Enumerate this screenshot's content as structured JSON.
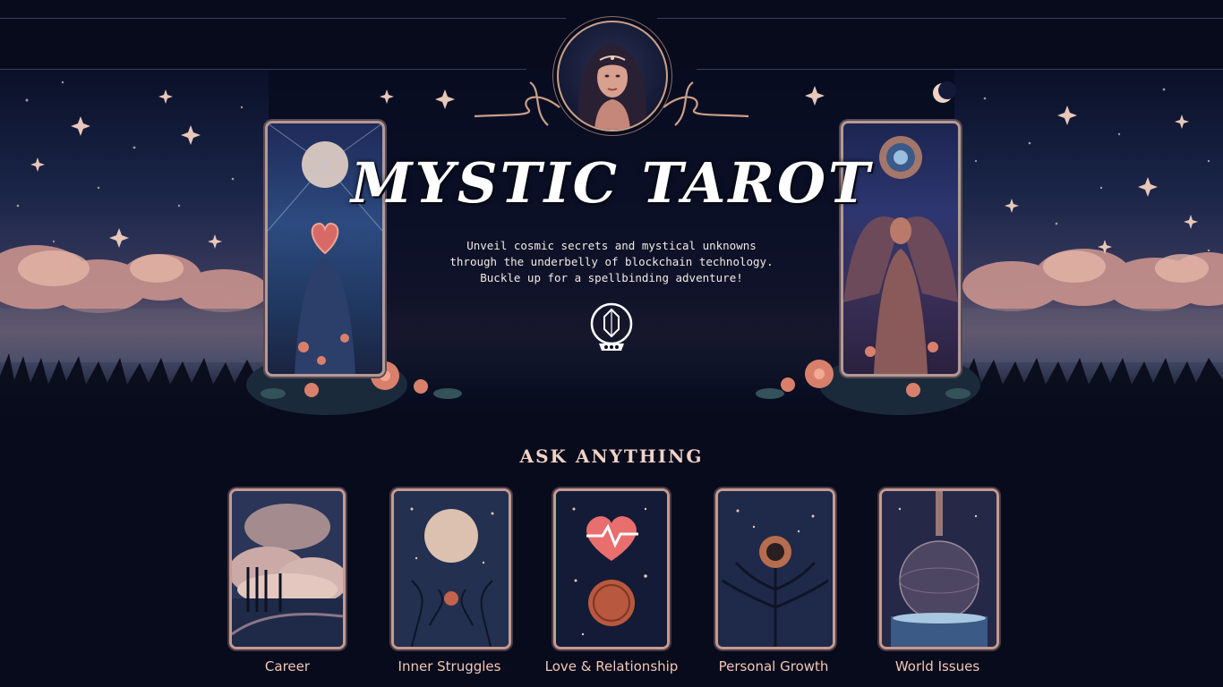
{
  "hero": {
    "title": "MYSTIC TAROT",
    "tagline": [
      "Unveil cosmic secrets and mystical unknowns",
      "through the underbelly of blockchain technology.",
      "Buckle up for a spellbinding adventure!"
    ]
  },
  "topics_section": {
    "heading": "ASK ANYTHING",
    "topics": [
      {
        "label": "Career",
        "icon": "cloud-landscape-card"
      },
      {
        "label": "Inner Struggles",
        "icon": "moon-branches-card"
      },
      {
        "label": "Love & Relationship",
        "icon": "heart-coin-card"
      },
      {
        "label": "Personal Growth",
        "icon": "sunflower-tree-card"
      },
      {
        "label": "World Issues",
        "icon": "globe-card"
      }
    ]
  },
  "colors": {
    "background": "#070b1c",
    "accent": "#f0d2c6",
    "card_border": "#c49b92"
  }
}
